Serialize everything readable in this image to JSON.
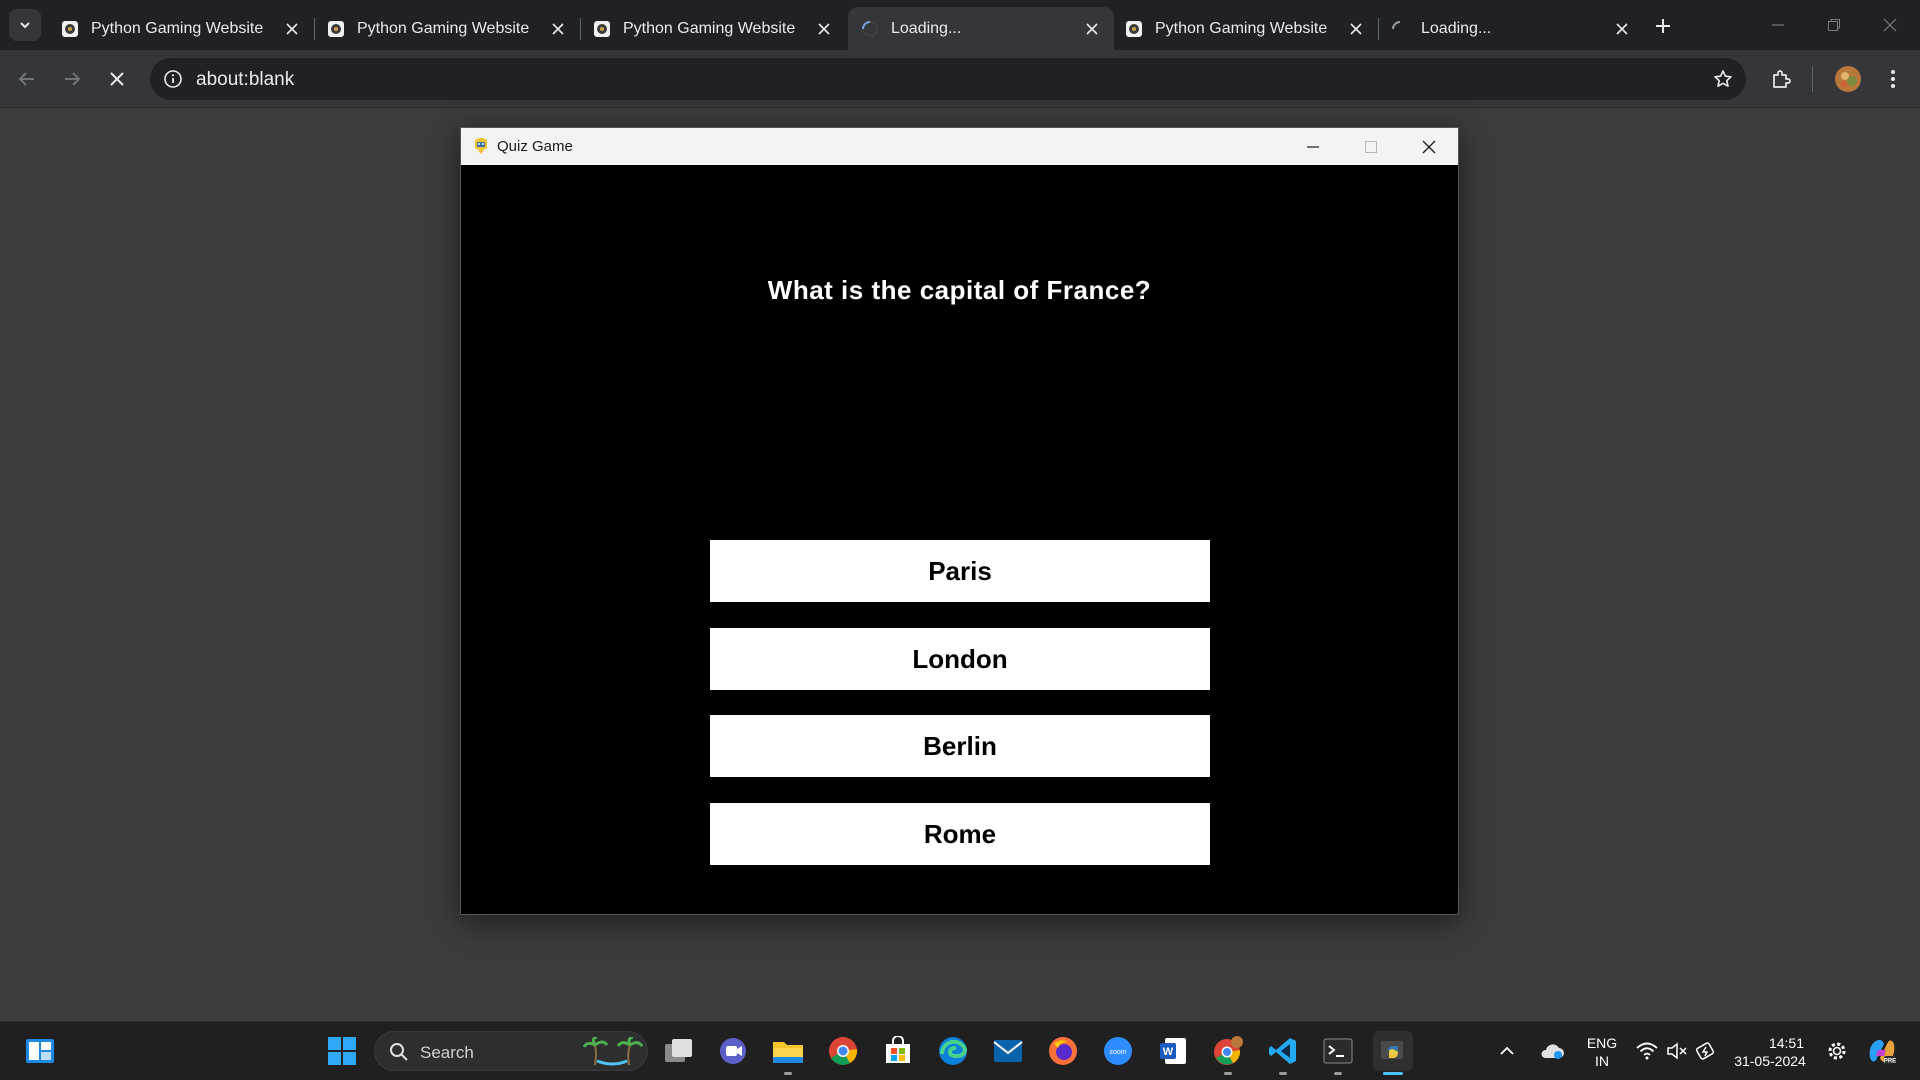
{
  "browser": {
    "tabs": [
      {
        "title": "Python Gaming Website",
        "loading": false
      },
      {
        "title": "Python Gaming Website",
        "loading": false
      },
      {
        "title": "Python Gaming Website",
        "loading": false
      },
      {
        "title": "Loading...",
        "loading": true,
        "active": true
      },
      {
        "title": "Python Gaming Website",
        "loading": false
      },
      {
        "title": "Loading...",
        "loading": true
      }
    ],
    "address": "about:blank"
  },
  "quiz_window": {
    "title": "Quiz Game",
    "question": "What is the capital of France?",
    "answers": [
      "Paris",
      "London",
      "Berlin",
      "Rome"
    ]
  },
  "taskbar": {
    "search_placeholder": "Search",
    "language": "ENG",
    "region": "IN",
    "time": "14:51",
    "date": "31-05-2024"
  },
  "colors": {
    "browser_frame": "#202124",
    "toolbar": "#35363a",
    "page_background": "#3c3c3c",
    "quiz_background": "#000000",
    "answer_button": "#ffffff",
    "taskbar": "#202020",
    "accent": "#4cc2ff"
  }
}
